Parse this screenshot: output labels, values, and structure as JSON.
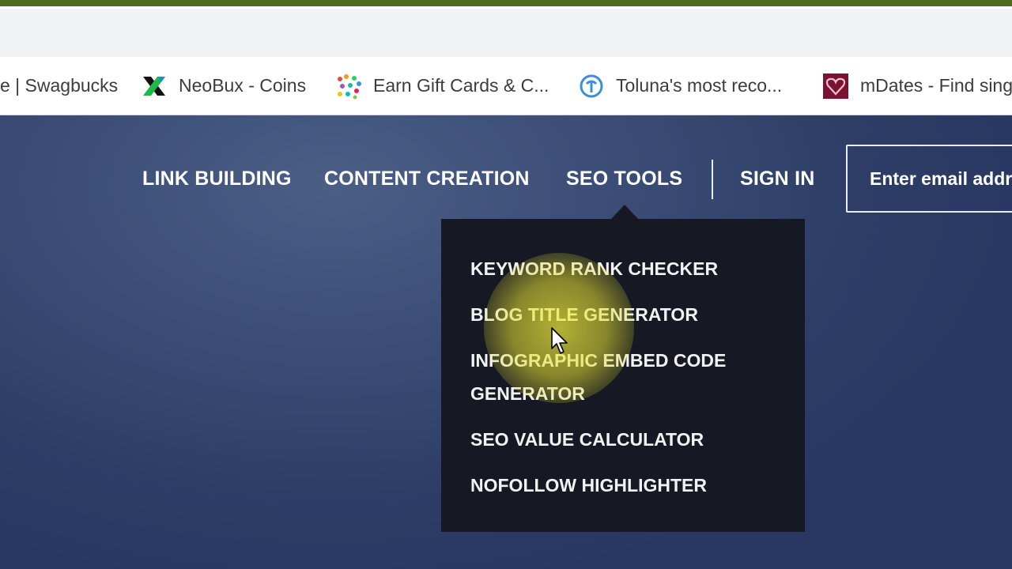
{
  "browser": {
    "bookmarks": [
      {
        "label": "e | Swagbucks",
        "icon": "none"
      },
      {
        "label": "NeoBux - Coins",
        "icon": "neobux-x-icon"
      },
      {
        "label": "Earn Gift Cards & C...",
        "icon": "colorful-dots-icon"
      },
      {
        "label": "Toluna's most reco...",
        "icon": "toluna-icon"
      },
      {
        "label": "mDates - Find sing",
        "icon": "heart-icon"
      }
    ]
  },
  "nav": {
    "link_building": "LINK BUILDING",
    "content_creation": "CONTENT CREATION",
    "seo_tools": "SEO TOOLS",
    "sign_in": "SIGN IN",
    "email_placeholder": "Enter email addre"
  },
  "seo_tools_menu": {
    "items": [
      "KEYWORD RANK CHECKER",
      "BLOG TITLE GENERATOR",
      "INFOGRAPHIC EMBED CODE GENERATOR",
      "SEO VALUE CALCULATOR",
      "NOFOLLOW HIGHLIGHTER"
    ]
  },
  "colors": {
    "hero_bg": "#2d3d66",
    "dropdown_bg": "#161924",
    "browser_top_accent": "#4f6a1a",
    "cursor_highlight": "#e6e132"
  }
}
